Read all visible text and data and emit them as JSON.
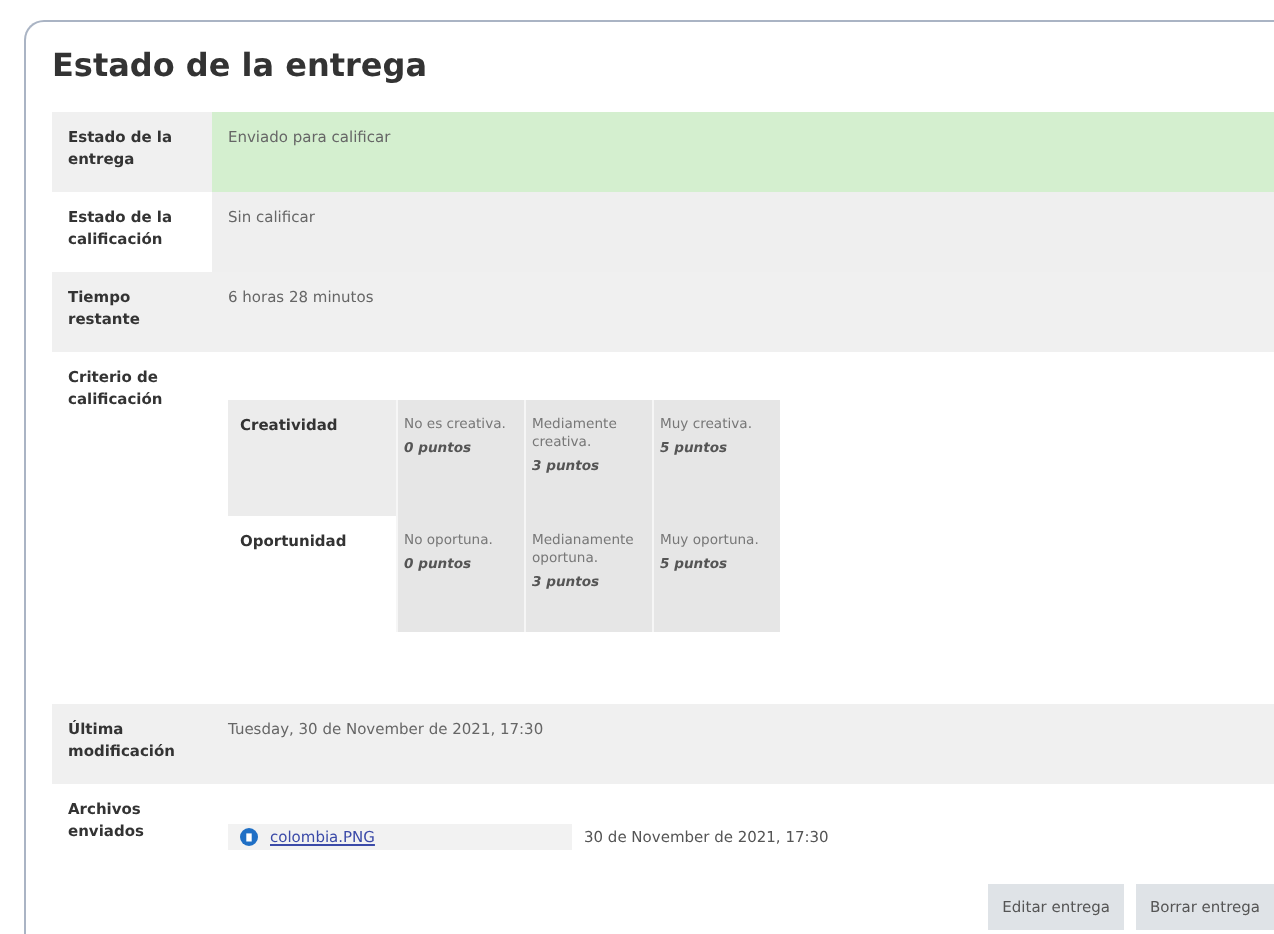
{
  "title": "Estado de la entrega",
  "rows": [
    {
      "kind": "text",
      "label": "Estado de la entrega",
      "value": "Enviado para calificar",
      "success": true
    },
    {
      "kind": "text",
      "label": "Estado de la calificación",
      "value": "Sin calificar",
      "success": false
    },
    {
      "kind": "text",
      "label": "Tiempo restante",
      "value": "6 horas 28 minutos"
    },
    {
      "kind": "rubric",
      "label": "Criterio de calificación",
      "criteria": [
        {
          "name": "Creatividad",
          "levels": [
            {
              "definition": "No es creativa.",
              "score": "0 puntos"
            },
            {
              "definition": "Mediamente creativa.",
              "score": "3 puntos"
            },
            {
              "definition": "Muy creativa.",
              "score": "5 puntos"
            }
          ]
        },
        {
          "name": "Oportunidad",
          "levels": [
            {
              "definition": "No oportuna.",
              "score": "0 puntos"
            },
            {
              "definition": "Medianamente oportuna.",
              "score": "3 puntos"
            },
            {
              "definition": "Muy oportuna.",
              "score": "5 puntos"
            }
          ]
        }
      ]
    },
    {
      "kind": "text",
      "label": "Última modificación",
      "value": "Tuesday, 30 de November de 2021, 17:30"
    },
    {
      "kind": "files",
      "label": "Archivos enviados",
      "files": [
        {
          "name": "colombia.PNG",
          "date": "30 de November de 2021, 17:30"
        }
      ]
    }
  ],
  "buttons": [
    "Editar entrega",
    "Borrar entrega"
  ]
}
